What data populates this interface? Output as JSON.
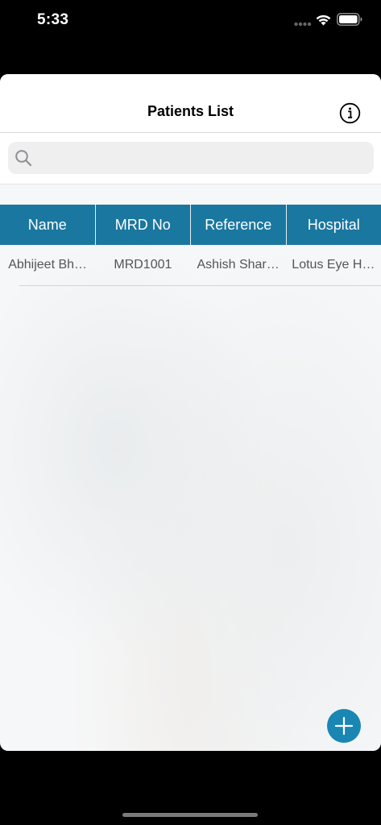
{
  "status_bar": {
    "time": "5:33"
  },
  "nav": {
    "title": "Patients List",
    "info_icon": "info-icon"
  },
  "search": {
    "value": "",
    "placeholder": "",
    "icon": "search-icon"
  },
  "table": {
    "columns": [
      "Name",
      "MRD No",
      "Reference",
      "Hospital"
    ],
    "rows": [
      {
        "name": "Abhijeet Bh…",
        "mrd_no": "MRD1001",
        "reference": "Ashish Shar…",
        "hospital": "Lotus Eye H…"
      }
    ],
    "header_color": "#1a779f"
  },
  "fab": {
    "icon": "plus-icon",
    "color": "#1a86b3"
  }
}
